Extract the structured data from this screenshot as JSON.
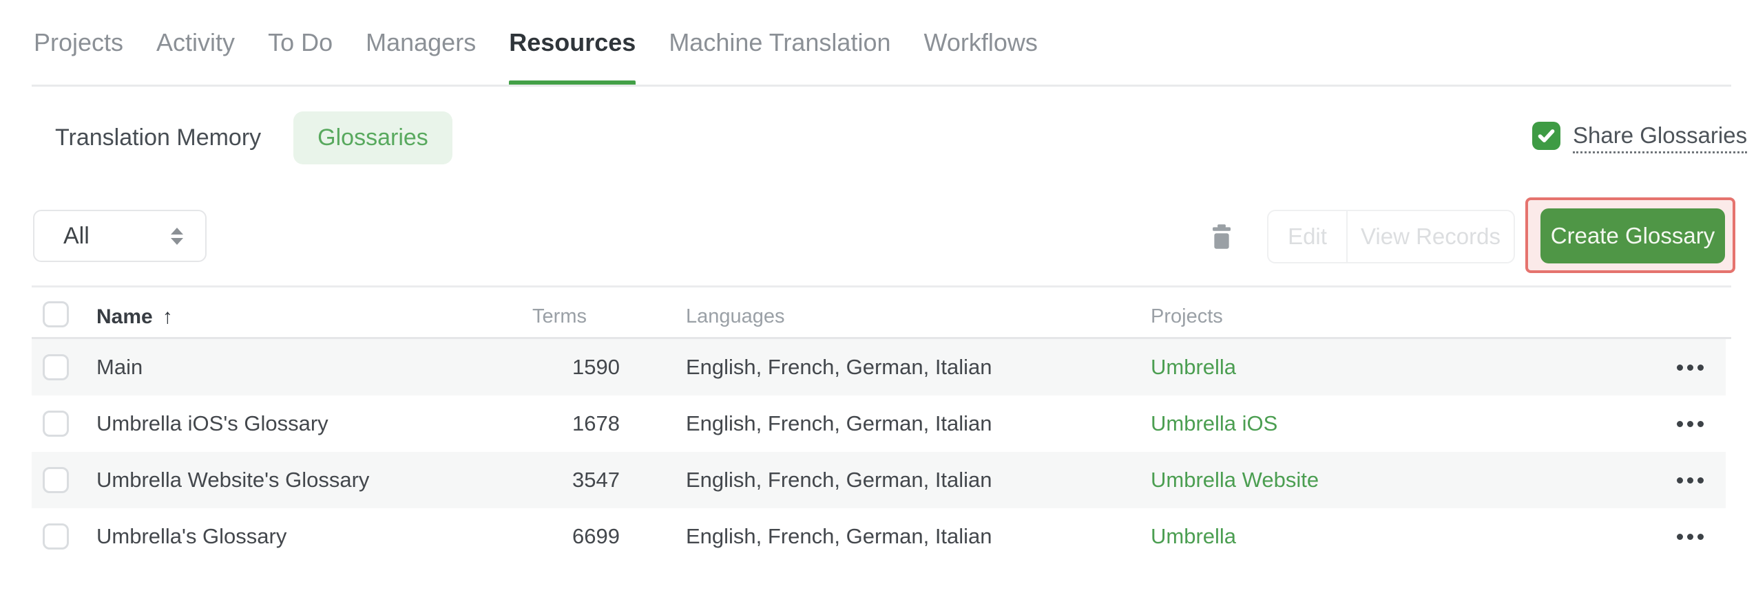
{
  "nav": {
    "items": [
      {
        "label": "Projects"
      },
      {
        "label": "Activity"
      },
      {
        "label": "To Do"
      },
      {
        "label": "Managers"
      },
      {
        "label": "Resources"
      },
      {
        "label": "Machine Translation"
      },
      {
        "label": "Workflows"
      }
    ],
    "active_label": "Resources"
  },
  "subtabs": {
    "items": [
      {
        "label": "Translation Memory"
      },
      {
        "label": "Glossaries"
      }
    ],
    "active_label": "Glossaries"
  },
  "share": {
    "label": "Share Glossaries",
    "checked": true,
    "checkbox_icon": "checkmark-icon"
  },
  "toolbar": {
    "filter_value": "All",
    "trash_icon": "trash-icon",
    "edit_label": "Edit",
    "view_records_label": "View Records",
    "create_label": "Create Glossary",
    "edit_enabled": false,
    "view_records_enabled": false
  },
  "table": {
    "headers": {
      "name": "Name",
      "terms": "Terms",
      "languages": "Languages",
      "projects": "Projects"
    },
    "sort": {
      "column": "Name",
      "direction": "ascending",
      "arrow": "↑"
    },
    "rows": [
      {
        "name": "Main",
        "terms": "1590",
        "languages": "English, French, German, Italian",
        "project": "Umbrella"
      },
      {
        "name": "Umbrella iOS's Glossary",
        "terms": "1678",
        "languages": "English, French, German, Italian",
        "project": "Umbrella iOS"
      },
      {
        "name": "Umbrella Website's Glossary",
        "terms": "3547",
        "languages": "English, French, German, Italian",
        "project": "Umbrella Website"
      },
      {
        "name": "Umbrella's Glossary",
        "terms": "6699",
        "languages": "English, French, German, Italian",
        "project": "Umbrella"
      }
    ],
    "row_menu_icon": "ellipsis-icon"
  },
  "colors": {
    "accent_green": "#43a047",
    "button_green": "#4f9646",
    "link_green": "#4b9e51",
    "pill_bg": "#e9f4ea",
    "pill_text": "#58a95e",
    "checkbox_green": "#3e9b44",
    "highlight_border": "#e5736e",
    "highlight_fill": "#fbeae9",
    "stripe_gray": "#f6f7f7",
    "nav_inactive": "#8b9096",
    "nav_active": "#2f353a",
    "header_gray": "#9aa0a6",
    "disabled_text": "#dcdee0"
  }
}
